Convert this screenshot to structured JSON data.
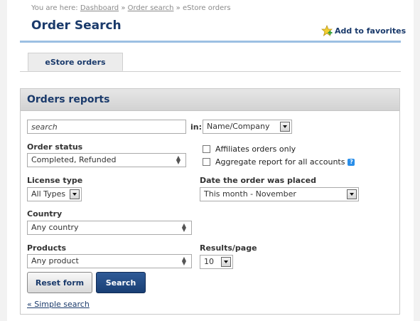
{
  "breadcrumb": {
    "prefix": "You are here:",
    "dashboard": "Dashboard",
    "sep1": "»",
    "order_search": "Order search",
    "sep2": "»",
    "current": "eStore orders"
  },
  "header": {
    "title": "Order Search",
    "favorites": "Add to favorites"
  },
  "tabs": [
    {
      "label": "eStore orders",
      "active": true
    }
  ],
  "panel": {
    "title": "Orders reports",
    "search": {
      "value": "search",
      "in_label": "in:",
      "in_value": "Name/Company"
    },
    "order_status": {
      "label": "Order status",
      "value": "Completed, Refunded"
    },
    "affiliates_only": {
      "label": "Affiliates orders only",
      "checked": false
    },
    "aggregate": {
      "label": "Aggregate report for all accounts",
      "checked": false,
      "help": "?"
    },
    "license_type": {
      "label": "License type",
      "value": "All Types"
    },
    "date_placed": {
      "label": "Date the order was placed",
      "value": "This month - November"
    },
    "country": {
      "label": "Country",
      "value": "Any country"
    },
    "products": {
      "label": "Products",
      "value": "Any product"
    },
    "results_page": {
      "label": "Results/page",
      "value": "10"
    },
    "reset_label": "Reset form",
    "search_label": "Search",
    "simple_link": "« Simple search"
  },
  "colors": {
    "title_blue": "#1a3a6b",
    "search_button": "#1f4a85",
    "rule_blue": "#9cc0e3",
    "help_blue": "#2a8ee8"
  }
}
